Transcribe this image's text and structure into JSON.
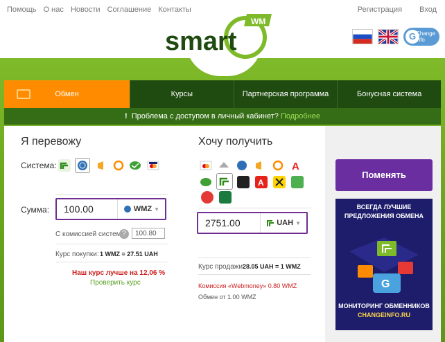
{
  "topnav": {
    "items": [
      "Помощь",
      "О нас",
      "Новости",
      "Соглашение",
      "Контакты"
    ]
  },
  "auth": {
    "register": "Регистрация",
    "login": "Вход"
  },
  "logo": {
    "text": "smart",
    "badge": "WM"
  },
  "change_info": {
    "line1": "Change",
    "line2": "info",
    "glyph": "G"
  },
  "menu": {
    "items": [
      "Обмен",
      "Курсы",
      "Партнерская программа",
      "Бонусная система"
    ]
  },
  "notice": {
    "mark": "!",
    "text": "Проблема с доступом в личный кабинет?",
    "link": "Подробнее"
  },
  "send": {
    "title": "Я перевожу",
    "system_label": "Система:",
    "amount_label": "Сумма:",
    "amount": "100.00",
    "currency": "WMZ",
    "commission_label": "С комиссией системы:",
    "commission_value": "100.80",
    "rate_label": "Курс покупки:",
    "rate_value": "1 WMZ = 27.51 UAH",
    "better": "Наш курс лучше на 12,06 %",
    "check": "Проверить курс"
  },
  "receive": {
    "title": "Хочу получить",
    "amount": "2751.00",
    "currency": "UAH",
    "rate_label": "Курс продажи:",
    "rate_value": "28.05 UAH = 1 WMZ",
    "commission": "Комиссия «Webmoney» 0.80 WMZ",
    "exchange": "Обмен от 1.00 WMZ"
  },
  "side": {
    "button": "Поменять",
    "banner_line1": "ВСЕГДА ЛУЧШИЕ",
    "banner_line2": "ПРЕДЛОЖЕНИЯ ОБМЕНА",
    "banner_line3": "МОНИТОРИНГ ОБМЕННИКОВ",
    "banner_line4": "CHANGEINFO.RU"
  },
  "colors": {
    "green": "#7fba2a",
    "menu": "#1f4a10",
    "active": "#ff8c00",
    "purple": "#6b2ea0",
    "banner": "#1e1d6b"
  }
}
